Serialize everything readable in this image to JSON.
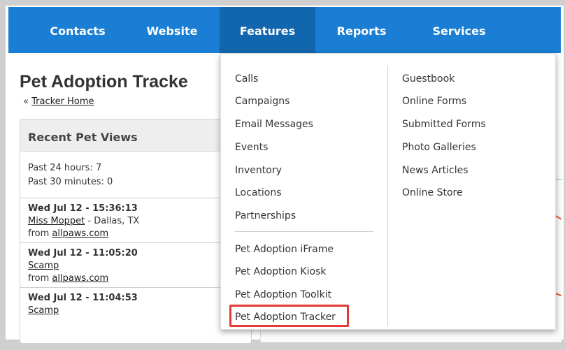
{
  "nav": {
    "items": [
      {
        "label": "Contacts"
      },
      {
        "label": "Website"
      },
      {
        "label": "Features"
      },
      {
        "label": "Reports"
      },
      {
        "label": "Services"
      }
    ],
    "active": "Features"
  },
  "page": {
    "title": "Pet Adoption Tracke",
    "breadcrumb_prefix": "«",
    "breadcrumb_link": "Tracker Home"
  },
  "recent_views": {
    "title": "Recent Pet Views",
    "past_24": "Past 24 hours: 7",
    "past_30": "Past 30 minutes: 0",
    "entries": [
      {
        "timestamp": "Wed Jul 12 - 15:36:13",
        "pet": "Miss Moppet",
        "location": " - Dallas, TX",
        "from_prefix": "from ",
        "source": "allpaws.com"
      },
      {
        "timestamp": "Wed Jul 12 - 11:05:20",
        "pet": "Scamp",
        "location": "",
        "from_prefix": "from ",
        "source": "allpaws.com"
      },
      {
        "timestamp": "Wed Jul 12 - 11:04:53",
        "pet": "Scamp",
        "location": "",
        "from_prefix": "",
        "source": ""
      }
    ]
  },
  "dropdown": {
    "left_items": [
      "Calls",
      "Campaigns",
      "Email Messages",
      "Events",
      "Inventory",
      "Locations",
      "Partnerships"
    ],
    "left_items_b": [
      "Pet Adoption iFrame",
      "Pet Adoption Kiosk",
      "Pet Adoption Toolkit",
      "Pet Adoption Tracker"
    ],
    "right_items": [
      "Guestbook",
      "Online Forms",
      "Submitted Forms",
      "Photo Galleries",
      "News Articles",
      "Online Store"
    ],
    "highlighted": "Pet Adoption Tracker"
  },
  "colors": {
    "nav_bg": "#1a7fd4",
    "nav_active": "#1266ad",
    "highlight_border": "#e53935"
  }
}
